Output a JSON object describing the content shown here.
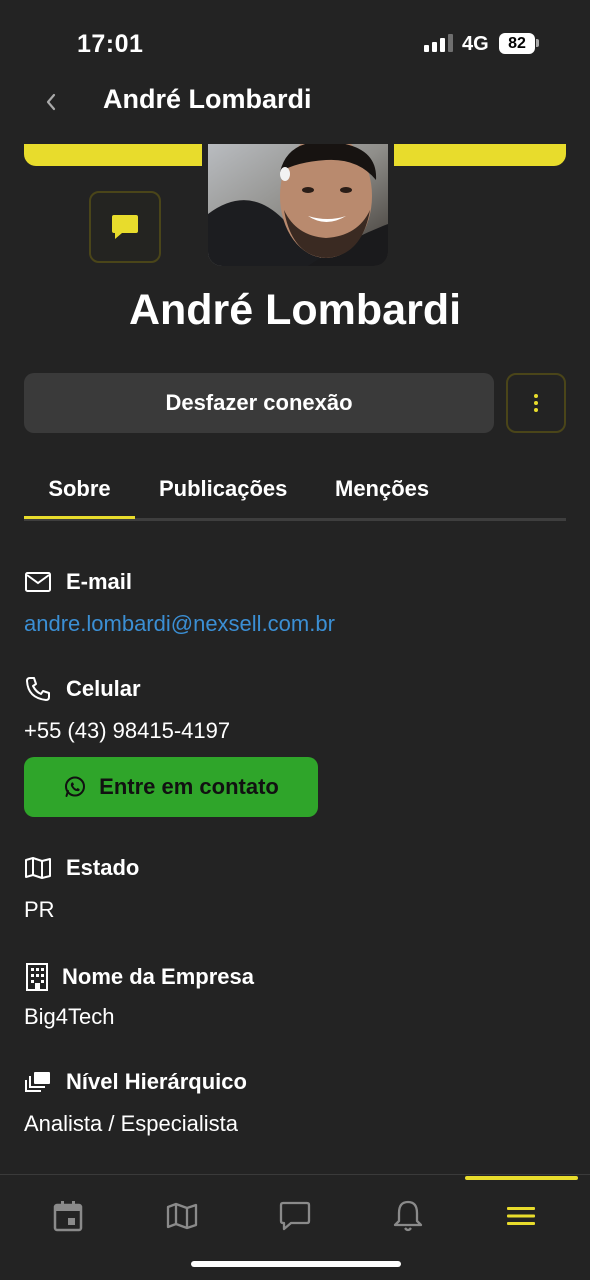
{
  "status_bar": {
    "time": "17:01",
    "network": "4G",
    "battery": "82"
  },
  "header": {
    "title": "André Lombardi"
  },
  "profile": {
    "name": "André Lombardi",
    "disconnect_label": "Desfazer conexão"
  },
  "tabs": [
    {
      "label": "Sobre",
      "active": true
    },
    {
      "label": "Publicações",
      "active": false
    },
    {
      "label": "Menções",
      "active": false
    }
  ],
  "about": {
    "email": {
      "label": "E-mail",
      "value": "andre.lombardi@nexsell.com.br"
    },
    "phone": {
      "label": "Celular",
      "value": "+55 (43) 98415-4197",
      "contact_label": "Entre em contato"
    },
    "state": {
      "label": "Estado",
      "value": "PR"
    },
    "company": {
      "label": "Nome da Empresa",
      "value": "Big4Tech"
    },
    "level": {
      "label": "Nível Hierárquico",
      "value": "Analista / Especialista"
    }
  },
  "bottom_nav": {
    "items": [
      "calendar-icon",
      "map-icon",
      "chat-icon",
      "bell-icon",
      "menu-icon"
    ],
    "active": "menu-icon"
  },
  "colors": {
    "accent": "#e8dc2c",
    "background": "#232323",
    "whatsapp": "#2fa52a",
    "link": "#3b8fd4"
  }
}
